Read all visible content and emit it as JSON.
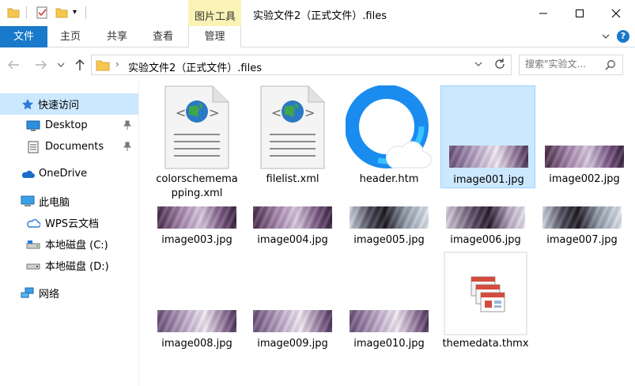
{
  "window": {
    "title": "实验文件2（正式文件）.files",
    "context_tab_group": "图片工具"
  },
  "ribbon": {
    "tabs": [
      {
        "label": "文件"
      },
      {
        "label": "主页"
      },
      {
        "label": "共享"
      },
      {
        "label": "查看"
      },
      {
        "label": "管理"
      }
    ],
    "help": "?"
  },
  "address": {
    "path": "实验文件2（正式文件）.files",
    "separator": "›"
  },
  "search": {
    "placeholder": "搜索\"实验文..."
  },
  "sidebar": {
    "items": [
      {
        "label": "快速访问",
        "icon": "star-icon"
      },
      {
        "label": "Desktop",
        "icon": "desktop-icon",
        "pinned": true
      },
      {
        "label": "Documents",
        "icon": "documents-icon",
        "pinned": true
      },
      {
        "label": "OneDrive",
        "icon": "cloud-icon"
      },
      {
        "label": "此电脑",
        "icon": "computer-icon"
      },
      {
        "label": "WPS云文档",
        "icon": "wps-cloud-icon"
      },
      {
        "label": "本地磁盘 (C:)",
        "icon": "drive-icon"
      },
      {
        "label": "本地磁盘 (D:)",
        "icon": "drive-icon"
      },
      {
        "label": "网络",
        "icon": "network-icon"
      }
    ]
  },
  "files": [
    {
      "name": "colorschememapping.xml",
      "line1": "colorschemema",
      "line2": "pping.xml",
      "icon": "xml-file-icon"
    },
    {
      "name": "filelist.xml",
      "line1": "filelist.xml",
      "line2": "",
      "icon": "xml-file-icon"
    },
    {
      "name": "header.htm",
      "line1": "header.htm",
      "line2": "",
      "icon": "browser-html-icon"
    },
    {
      "name": "image001.jpg",
      "line1": "image001.jpg",
      "line2": "",
      "icon": "jpg-thumbnail",
      "selected": true
    },
    {
      "name": "image002.jpg",
      "line1": "image002.jpg",
      "line2": "",
      "icon": "jpg-thumbnail"
    },
    {
      "name": "image003.jpg",
      "line1": "image003.jpg",
      "line2": "",
      "icon": "jpg-thumbnail"
    },
    {
      "name": "image004.jpg",
      "line1": "image004.jpg",
      "line2": "",
      "icon": "jpg-thumbnail"
    },
    {
      "name": "image005.jpg",
      "line1": "image005.jpg",
      "line2": "",
      "icon": "jpg-thumbnail"
    },
    {
      "name": "image006.jpg",
      "line1": "image006.jpg",
      "line2": "",
      "icon": "jpg-thumbnail"
    },
    {
      "name": "image007.jpg",
      "line1": "image007.jpg",
      "line2": "",
      "icon": "jpg-thumbnail"
    },
    {
      "name": "image008.jpg",
      "line1": "image008.jpg",
      "line2": "",
      "icon": "jpg-thumbnail"
    },
    {
      "name": "image009.jpg",
      "line1": "image009.jpg",
      "line2": "",
      "icon": "jpg-thumbnail"
    },
    {
      "name": "image010.jpg",
      "line1": "image010.jpg",
      "line2": "",
      "icon": "jpg-thumbnail"
    },
    {
      "name": "themedata.thmx",
      "line1": "themedata.thmx",
      "line2": "",
      "icon": "theme-file-icon"
    }
  ],
  "colors": {
    "accent": "#1979ca",
    "selection": "#cce8ff",
    "context_tab": "#fbf3b5"
  }
}
